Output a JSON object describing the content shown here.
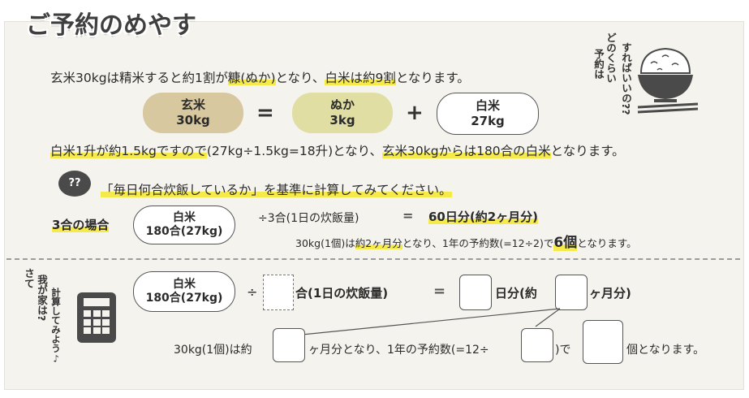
{
  "title": "ご予約のめやす",
  "line1": {
    "a": "玄米30kgは精米すると約1割が",
    "hl1": "糠(ぬか)",
    "b": "となり、",
    "hl2": "白米は約9割",
    "c": "となります。"
  },
  "pills": {
    "brown": {
      "name": "玄米",
      "amount": "30kg"
    },
    "equals": "=",
    "bran": {
      "name": "ぬか",
      "amount": "3kg"
    },
    "plus": "+",
    "white": {
      "name": "白米",
      "amount": "27kg"
    }
  },
  "line2": {
    "hl1": "白米1升が約1.5kgですので",
    "a": "(27kg÷1.5kg=18升)となり、",
    "hl2": "玄米30kgからは180合の白米",
    "b": "となります。"
  },
  "bubble": "??",
  "question": "「毎日何合炊飯しているか」を基準に計算してみてください。",
  "example": {
    "label": "3合の場合",
    "pill": {
      "name": "白米",
      "amount": "180合(27kg)"
    },
    "divide": "÷3合(1日の炊飯量)",
    "equals": "=",
    "result": "60日分(約2ヶ月分)",
    "sub_a": "30kg(1個)は",
    "sub_hl": "約2ヶ月分",
    "sub_b": "となり、1年の予約数(=12÷2)で",
    "sub_big": "6個",
    "sub_c": "となります。"
  },
  "worksheet": {
    "label_vertical_1": "さて",
    "label_vertical_2": "我が家は?",
    "label_vertical_3": "計算してみよう♪",
    "pill": {
      "name": "白米",
      "amount": "180合(27kg)"
    },
    "div_sign": "÷",
    "unit_a": "合(1日の炊飯量)",
    "equals": "=",
    "unit_b": "日分(約",
    "unit_c": "ヶ月分)",
    "row2_a": "30kg(1個)は約",
    "row2_b": "ヶ月分となり、1年の予約数(=12÷",
    "row2_c": ")で",
    "row2_d": "個となります。"
  },
  "illustration": {
    "text_1": "どのくらい",
    "text_2": "予約は",
    "text_3": "すればいいの??",
    "icon": "rice-bowl-icon"
  },
  "colors": {
    "highlight": "#f5ea4a",
    "panel": "#f4f3ee",
    "tan": "#d8c8a0",
    "lime": "#e0dea2",
    "dark": "#4a4a4a"
  }
}
